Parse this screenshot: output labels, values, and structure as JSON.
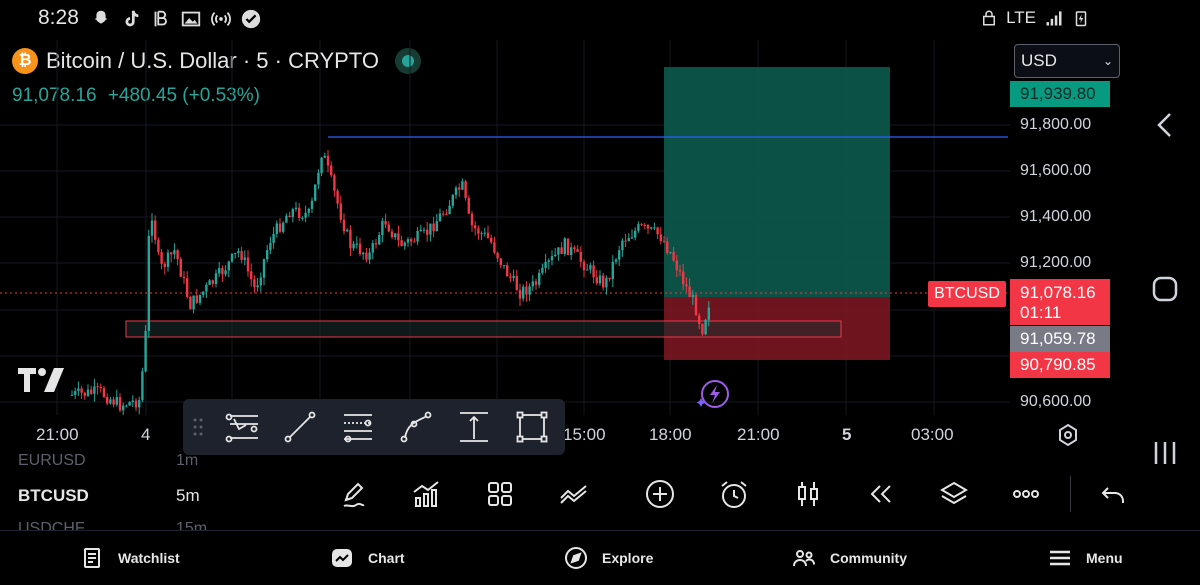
{
  "status": {
    "time": "8:28",
    "network": "LTE"
  },
  "header": {
    "title": "Bitcoin / U.S. Dollar · 5 · CRYPTO",
    "coin_glyph": "₿",
    "last": "91,078.16",
    "change": "+480.45 (+0.53%)",
    "currency": "USD"
  },
  "price_scale": {
    "labels": [
      "91,800.00",
      "91,600.00",
      "91,400.00",
      "91,200.00",
      "90,600.00"
    ],
    "target": "91,939.80",
    "current": "91,078.16",
    "countdown": "01:11",
    "entry": "91,059.78",
    "stop": "90,790.85",
    "symbol_tag": "BTCUSD"
  },
  "time_axis": [
    "21:00",
    "4",
    "15:00",
    "18:00",
    "21:00",
    "5",
    "03:00"
  ],
  "symbol_bar": {
    "prev_symbol": "EURUSD",
    "prev_interval": "1m",
    "symbol": "BTCUSD",
    "interval": "5m",
    "next_symbol": "USDCHF",
    "next_interval": "15m"
  },
  "nav": {
    "watchlist": "Watchlist",
    "chart": "Chart",
    "explore": "Explore",
    "community": "Community",
    "menu": "Menu"
  },
  "colors": {
    "up": "#26a69a",
    "down": "#f23645",
    "background": "#000000",
    "panel": "#1e222d"
  }
}
